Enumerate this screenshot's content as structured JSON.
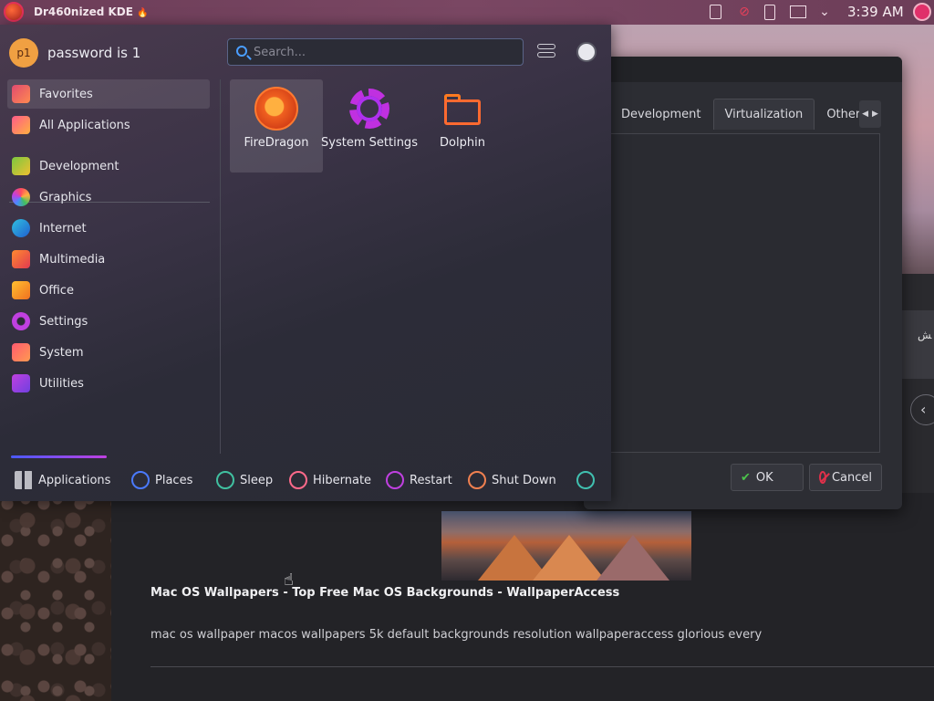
{
  "top_panel": {
    "title": "Dr460nized KDE",
    "title_icon": "flame-icon",
    "clock": "3:39 AM",
    "tray_icons": [
      "clipboard-icon",
      "network-icon",
      "usb-icon",
      "display-icon",
      "chevron-down-icon",
      "user-icon"
    ]
  },
  "launcher": {
    "user": {
      "avatar_text": "p1",
      "name": "password is 1"
    },
    "search": {
      "placeholder": "Search...",
      "value": ""
    },
    "sidebar": {
      "items": [
        {
          "label": "Favorites",
          "icon": "favorites-icon",
          "selected": true
        },
        {
          "label": "All Applications",
          "icon": "all-apps-icon"
        },
        {
          "label": "Development",
          "icon": "development-icon"
        },
        {
          "label": "Graphics",
          "icon": "graphics-icon"
        },
        {
          "label": "Internet",
          "icon": "internet-icon"
        },
        {
          "label": "Multimedia",
          "icon": "multimedia-icon"
        },
        {
          "label": "Office",
          "icon": "office-icon"
        },
        {
          "label": "Settings",
          "icon": "settings-icon"
        },
        {
          "label": "System",
          "icon": "system-icon"
        },
        {
          "label": "Utilities",
          "icon": "utilities-icon"
        }
      ]
    },
    "favorites": [
      {
        "label": "FireDragon",
        "icon": "firedragon-icon",
        "selected": true
      },
      {
        "label": "System Settings",
        "icon": "gear-icon"
      },
      {
        "label": "Dolphin",
        "icon": "folder-icon"
      }
    ],
    "footer": {
      "applications": "Applications",
      "places": "Places",
      "sleep": "Sleep",
      "hibernate": "Hibernate",
      "restart": "Restart",
      "shut_down": "Shut Down"
    }
  },
  "dialog": {
    "tabs": [
      "Development",
      "Virtualization",
      "Other"
    ],
    "active_tab": "Virtualization",
    "ok": "OK",
    "cancel": "Cancel"
  },
  "browser": {
    "result_title": "Mac OS Wallpapers - Top Free Mac OS Backgrounds - WallpaperAccess",
    "result_desc": "mac os wallpaper macos wallpapers 5k default backgrounds resolution wallpaperaccess glorious every"
  },
  "colors": {
    "panel": "#6c3d58",
    "accent_blue": "#4a9eff",
    "accent_magenta": "#c040e0",
    "accent_orange": "#f07020"
  }
}
